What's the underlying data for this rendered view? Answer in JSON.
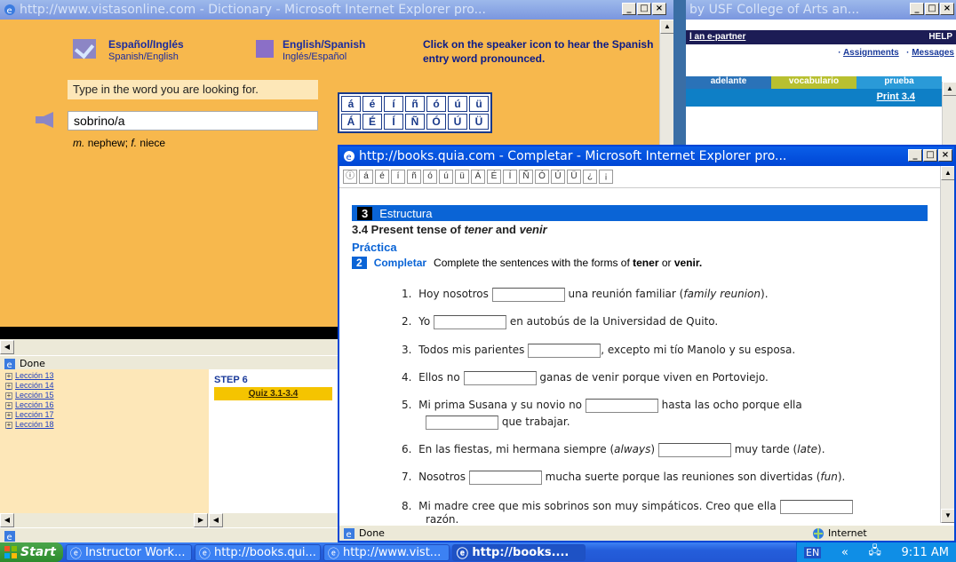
{
  "vista_window": {
    "title": "http://www.vistasonline.com - Dictionary - Microsoft Internet Explorer pro...",
    "option_es_en": {
      "title": "Español/Inglés",
      "subtitle": "Spanish/English"
    },
    "option_en_es": {
      "title": "English/Spanish",
      "subtitle": "Inglés/Español"
    },
    "speaker_hint": "Click on the speaker icon to hear the Spanish entry word pronounced.",
    "search_prompt": "Type in the word you are looking for.",
    "search_value": "sobrino/a",
    "accents_lower": [
      "á",
      "é",
      "í",
      "ñ",
      "ó",
      "ú",
      "ü"
    ],
    "accents_upper": [
      "Á",
      "É",
      "Í",
      "Ñ",
      "Ó",
      "Ú",
      "Ü"
    ],
    "definition_pos1": "m.",
    "definition_text1": "nephew;",
    "definition_pos2": "f.",
    "definition_text2": "niece",
    "status": "Done"
  },
  "bb_window": {
    "title": "by USF College of Arts an...",
    "link_partner": "l an e-partner",
    "link_help": "HELP",
    "link_assignments": "Assignments",
    "link_messages": "Messages",
    "tabs": [
      "adelante",
      "vocabulario",
      "prueba"
    ],
    "print_link": "Print 3.4"
  },
  "lessons_window": {
    "items": [
      "Lección 13",
      "Lección 14",
      "Lección 15",
      "Lección 16",
      "Lección 17",
      "Lección 18"
    ],
    "step_label": "STEP 6",
    "quiz_link": "Quiz 3.1-3.4"
  },
  "quia_window": {
    "title": "http://books.quia.com - Completar - Microsoft Internet Explorer pro...",
    "accent_buttons": [
      "á",
      "é",
      "í",
      "ñ",
      "ó",
      "ú",
      "ü",
      "Á",
      "É",
      "Í",
      "Ñ",
      "Ó",
      "Ú",
      "Ü",
      "¿",
      "¡"
    ],
    "section_num": "3",
    "section_title": "Estructura",
    "heading_prefix": "3.4 Present tense of ",
    "heading_tener": "tener",
    "heading_and": " and ",
    "heading_venir": "venir",
    "practica": "Práctica",
    "exercise_num": "2",
    "exercise_title": "Completar",
    "instructions": "Complete the sentences with the forms of ",
    "instr_tener": "tener",
    "instr_or": " or ",
    "instr_venir": "venir.",
    "sentences": [
      {
        "num": "1.",
        "before": "Hoy nosotros",
        "after": "una reunión familiar (",
        "it": "family reunion",
        "end": ")."
      },
      {
        "num": "2.",
        "before": "Yo",
        "after": "en autobús de la Universidad de Quito.",
        "it": "",
        "end": ""
      },
      {
        "num": "3.",
        "before": "Todos mis parientes",
        "after": ", excepto mi tío Manolo y su esposa.",
        "it": "",
        "end": ""
      },
      {
        "num": "4.",
        "before": "Ellos no",
        "after": "ganas de venir porque viven en Portoviejo.",
        "it": "",
        "end": ""
      },
      {
        "num": "5.",
        "before": "Mi prima Susana y su novio no",
        "after": "hasta las ocho porque ella",
        "it": "",
        "end": ""
      },
      {
        "num": "6.",
        "before": "En las fiestas, mi hermana siempre (",
        "it": "always",
        "mid": ")",
        "after": "muy tarde (",
        "it2": "late",
        "end": ")."
      },
      {
        "num": "7.",
        "before": "Nosotros",
        "after": "mucha suerte porque las reuniones son divertidas (",
        "it": "fun",
        "end": ")."
      },
      {
        "num": "8.",
        "before": "Mi madre cree que mis sobrinos son muy simpáticos. Creo que ella",
        "after": "",
        "it": "",
        "end": ""
      }
    ],
    "s5_line2": "que trabajar.",
    "s8_line2": "razón.",
    "status_left": "Done",
    "status_zone": "Internet"
  },
  "taskbar": {
    "start": "Start",
    "tasks": [
      "Instructor Work...",
      "http://books.qui...",
      "http://www.vist...",
      "http://books...."
    ],
    "lang": "EN",
    "time": "9:11 AM"
  },
  "colors": {
    "vista_bg": "#f7b84d",
    "quia_band": "#0a64d6",
    "title_active": "#0046d5"
  }
}
